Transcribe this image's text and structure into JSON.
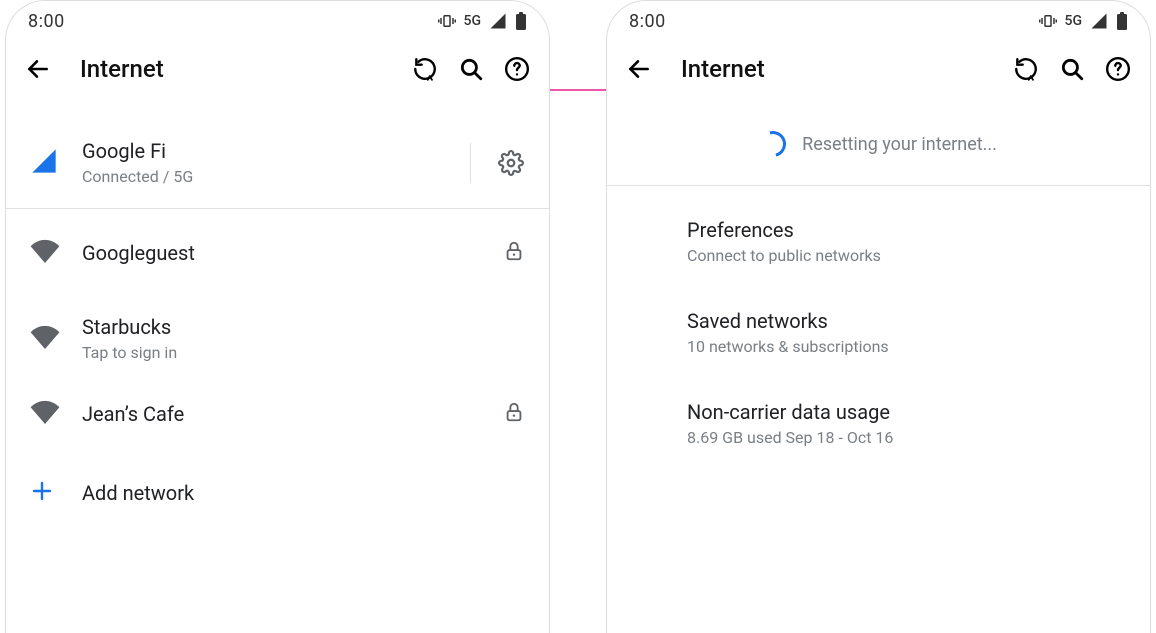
{
  "statusbar": {
    "time": "8:00",
    "network_label": "5G"
  },
  "appbar": {
    "title": "Internet"
  },
  "left": {
    "active": {
      "name": "Google Fi",
      "status": "Connected / 5G"
    },
    "wifi": [
      {
        "name": "Googleguest",
        "sub": "",
        "locked": true
      },
      {
        "name": "Starbucks",
        "sub": "Tap to sign in",
        "locked": false
      },
      {
        "name": "Jean’s Cafe",
        "sub": "",
        "locked": true
      }
    ],
    "add_network": "Add network"
  },
  "right": {
    "loading": "Resetting your internet...",
    "items": [
      {
        "title": "Preferences",
        "sub": "Connect to public networks"
      },
      {
        "title": "Saved networks",
        "sub": "10 networks & subscriptions"
      },
      {
        "title": "Non-carrier data usage",
        "sub": "8.69 GB used Sep 18 - Oct 16"
      }
    ]
  }
}
